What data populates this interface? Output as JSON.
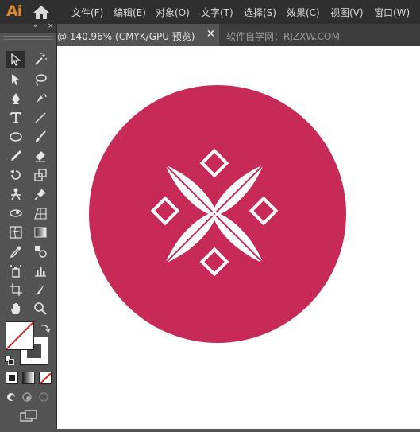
{
  "app": {
    "logo": "Ai"
  },
  "menu": {
    "items": [
      "文件(F)",
      "编辑(E)",
      "对象(O)",
      "文字(T)",
      "选择(S)",
      "效果(C)",
      "视图(V)",
      "窗口(W)"
    ]
  },
  "tabs": {
    "active": "@ 140.96% (CMYK/GPU 预览)",
    "close": "×",
    "second": "软件自学网：RJZXW.COM"
  },
  "toolbox": {
    "collapse": "«",
    "close": "×"
  },
  "colors": {
    "circle": "#c72a56",
    "motif": "#ffffff",
    "accent": "#d98a2e"
  },
  "tools": [
    "selection-tool",
    "magic-wand-tool",
    "direct-selection-tool",
    "lasso-tool",
    "pen-tool",
    "curvature-tool",
    "type-tool",
    "line-tool",
    "ellipse-tool",
    "paintbrush-tool",
    "pencil-tool",
    "eraser-tool",
    "rotate-tool",
    "scale-tool",
    "puppet-warp-tool",
    "pin-tool",
    "free-transform-tool",
    "perspective-grid-tool",
    "mesh-tool",
    "gradient-tool",
    "eyedropper-tool",
    "blend-tool",
    "symbol-sprayer-tool",
    "column-graph-tool",
    "artboard-tool",
    "slice-tool",
    "hand-tool",
    "zoom-tool"
  ]
}
